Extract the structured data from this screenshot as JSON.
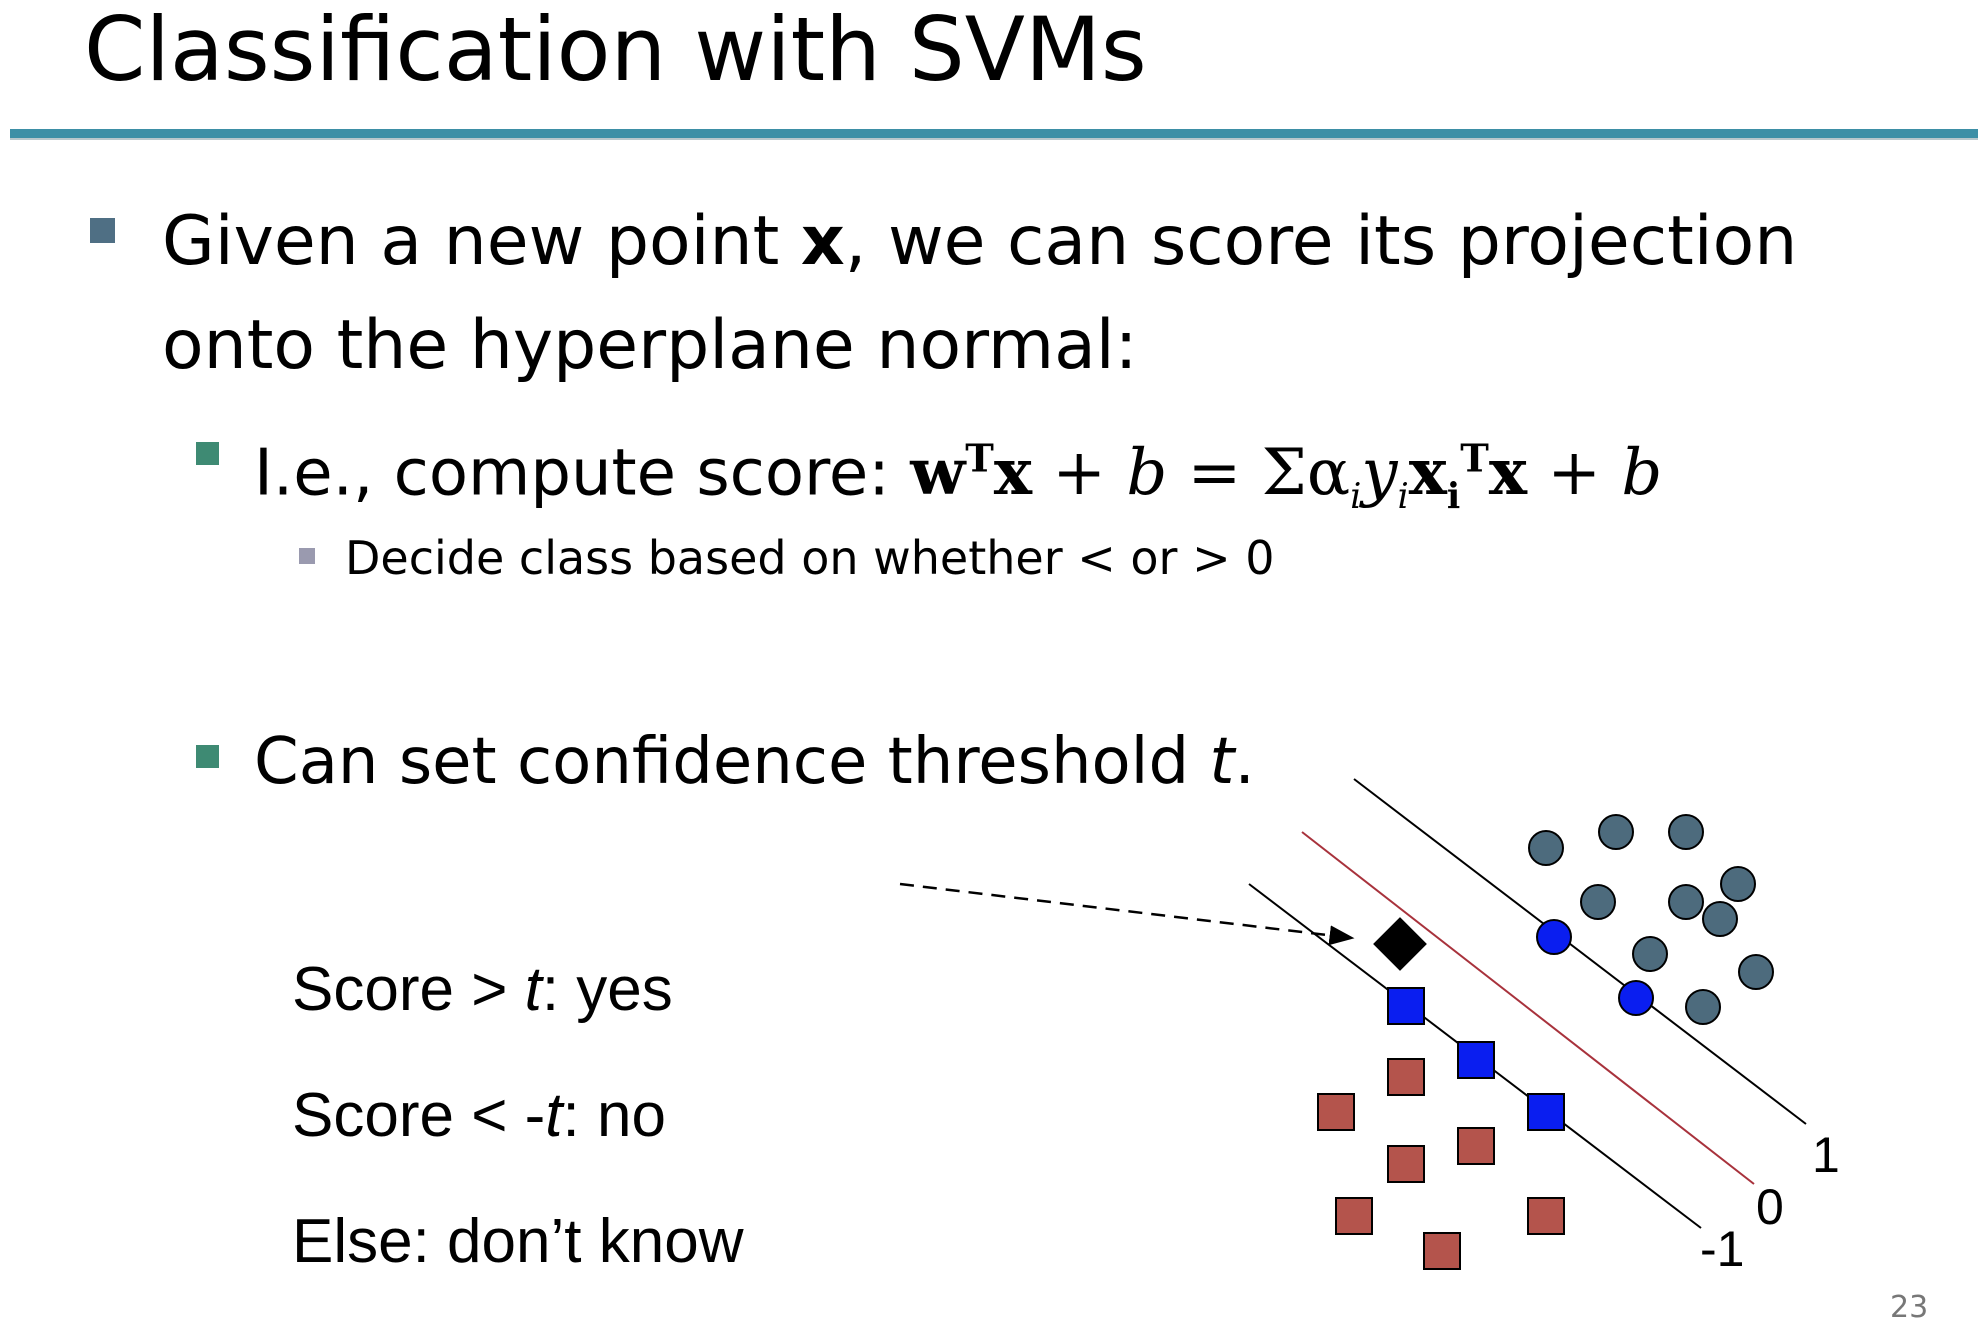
{
  "slide": {
    "title": "Classification with SVMs",
    "page_number": "23"
  },
  "bullets": {
    "b1_pre": "Given a new point ",
    "b1_bold": "x",
    "b1_post": ", we can score its projection",
    "b1_line2": "onto the hyperplane normal:",
    "b2_pre": "I.e., compute score: ",
    "b2_w": "w",
    "b2_T1": "T",
    "b2_x1": "x",
    "b2_plus1": " + ",
    "b2_b1": "b",
    "b2_eq": " = Σα",
    "b2_i1": "i",
    "b2_y": "y",
    "b2_i2": "i",
    "b2_xi": "x",
    "b2_i3": "i",
    "b2_T2": "T",
    "b2_x2": "x",
    "b2_plus2": " + ",
    "b2_b2": "b",
    "b3": "Decide class based on whether < or > 0",
    "b4_pre": "Can set confidence threshold ",
    "b4_t": "t",
    "b4_post": "."
  },
  "rules": {
    "yes_pre": "Score > ",
    "yes_t": "t",
    "yes_post": ": yes",
    "no_pre": "Score < -",
    "no_t": "t",
    "no_post": ": no",
    "else": "Else: don’t know"
  },
  "diagram": {
    "labels": {
      "plus": "1",
      "zero": "0",
      "minus": "-1"
    },
    "colors": {
      "positive_point": "#4d6b7d",
      "support_vector": "#0a1ef0",
      "negative_point": "#b4544c",
      "decision_line": "#a8323c",
      "new_point": "#000000"
    }
  }
}
